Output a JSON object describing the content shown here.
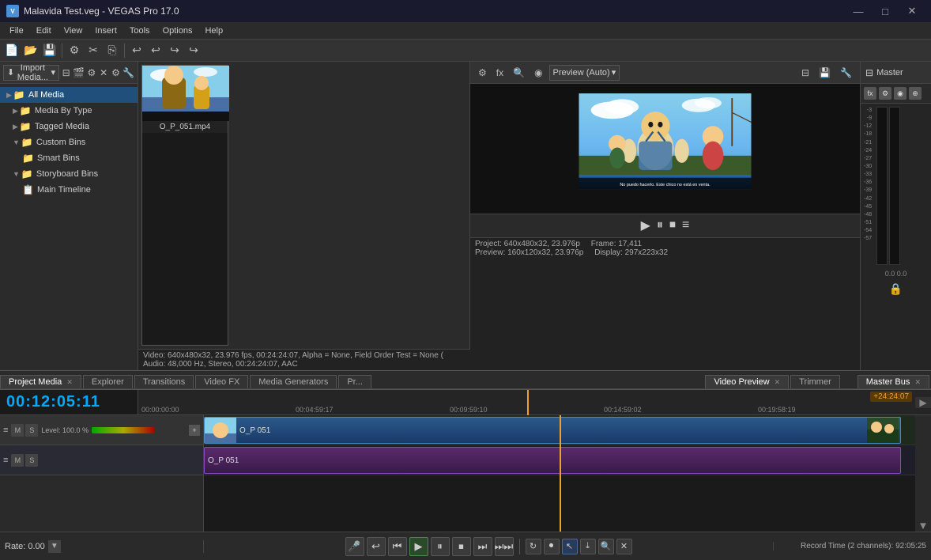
{
  "window": {
    "title": "Malavida Test.veg - VEGAS Pro 17.0",
    "icon": "V"
  },
  "titlebar": {
    "minimize": "—",
    "maximize": "□",
    "close": "✕"
  },
  "menu": {
    "items": [
      "File",
      "Edit",
      "View",
      "Insert",
      "Tools",
      "Options",
      "Help"
    ]
  },
  "media_toolbar": {
    "import_label": "Import Media...",
    "dropdown_arrow": "▾"
  },
  "tree": {
    "items": [
      {
        "label": "All Media",
        "level": 0,
        "type": "folder",
        "expanded": true,
        "selected": false
      },
      {
        "label": "Media By Type",
        "level": 1,
        "type": "folder",
        "expanded": false,
        "selected": false
      },
      {
        "label": "Tagged Media",
        "level": 1,
        "type": "folder",
        "expanded": false,
        "selected": false
      },
      {
        "label": "Custom Bins",
        "level": 1,
        "type": "folder",
        "expanded": true,
        "selected": false
      },
      {
        "label": "Smart Bins",
        "level": 2,
        "type": "folder",
        "expanded": false,
        "selected": false
      },
      {
        "label": "Storyboard Bins",
        "level": 1,
        "type": "folder",
        "expanded": true,
        "selected": false
      },
      {
        "label": "Main Timeline",
        "level": 2,
        "type": "timeline",
        "expanded": false,
        "selected": false
      }
    ]
  },
  "media_file": {
    "name": "O_P_051.mp4",
    "thumbnail_label": "O_P_051.mp4"
  },
  "preview": {
    "mode": "Preview (Auto)",
    "project_info": "Project: 640x480x32, 23.976p",
    "frame_label": "Frame:",
    "frame_value": "17,411",
    "display_label": "Display:",
    "display_value": "297x223x32",
    "preview_res": "Preview: 160x120x32, 23.976p"
  },
  "status_left": {
    "video": "Video: 640x480x32, 23.976 fps, 00:24:24:07, Alpha = None, Field Order Test = None (",
    "audio": "Audio: 48,000 Hz, Stereo, 00:24:24:07, AAC"
  },
  "panel_tabs": {
    "project_media": "Project Media",
    "explorer": "Explorer",
    "transitions": "Transitions",
    "video_fx": "Video FX",
    "media_generators": "Media Generators",
    "more": "Pr..."
  },
  "preview_tabs": {
    "video_preview": "Video Preview",
    "trimmer": "Trimmer"
  },
  "master": {
    "label": "Master",
    "bus_label": "Master Bus",
    "db_values": [
      "-3",
      "-9",
      "-12",
      "-18",
      "-21",
      "-24",
      "-27",
      "-30",
      "-33",
      "-36",
      "-39",
      "-42",
      "-45",
      "-48",
      "-51",
      "-54",
      "-57"
    ]
  },
  "timeline": {
    "time": "00:12:05:11",
    "end_time": "+24:24:07",
    "ruler_marks": [
      "00:00:00:00",
      "00:04:59:17",
      "00:09:59:10",
      "00:14:59:02",
      "00:19:58:19"
    ],
    "tracks": [
      {
        "id": 1,
        "type": "video",
        "label": "O_P 051",
        "level_pct": 100,
        "level_label": "Level: 100.0 %"
      },
      {
        "id": 2,
        "type": "audio",
        "label": "O_P 051"
      }
    ]
  },
  "transport": {
    "rate_label": "Rate: 0.00",
    "buttons": [
      "⏮",
      "⏪",
      "◀",
      "▶",
      "⏸",
      "⏹",
      "▶▶",
      "⏭"
    ],
    "record_time": "Record Time (2 channels): 92:05:25"
  }
}
